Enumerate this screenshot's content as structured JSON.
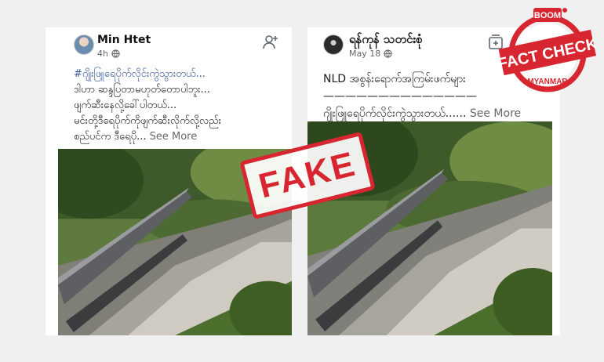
{
  "posts": [
    {
      "author": "Min Htet",
      "time": "4h",
      "caption_lines": [
        "#ဂျိုးဖြူရေပိုက်လိုင်းကွဲသွားတယ်...",
        "ဒါဟာ ဆန္ဒပြတာမဟုတ်တောပါဘူး...",
        "ဖျက်ဆီးနေလို့ခေါ်ပါတယ်...",
        "မင်းတို့ဒီရေပိုက်ကိုဖျက်ဆီးလိုက်လို့လည်း",
        "စည်ပင်က ဒီရေပို..."
      ],
      "see_more": "See More"
    },
    {
      "author": "ရန်ကုန် သတင်းစုံ",
      "time": "May 18",
      "caption_lines": [
        "NLD အစွန်းရောက်အကြမ်းဖက်များ",
        "——————————————",
        "ဂျိုးဖြူရေပိုက်လိုင်းကွဲသွားတယ်......"
      ],
      "see_more": "See More"
    }
  ],
  "stamp": "FAKE",
  "badge": {
    "top": "BOOM",
    "main": "FACT CHECK",
    "bottom": "MYANMAR"
  },
  "colors": {
    "brand_red": "#d7262f",
    "link_blue": "#385898",
    "meta_gray": "#65676b"
  },
  "icons": [
    "add-friend-icon",
    "globe-icon",
    "collage-icon"
  ]
}
